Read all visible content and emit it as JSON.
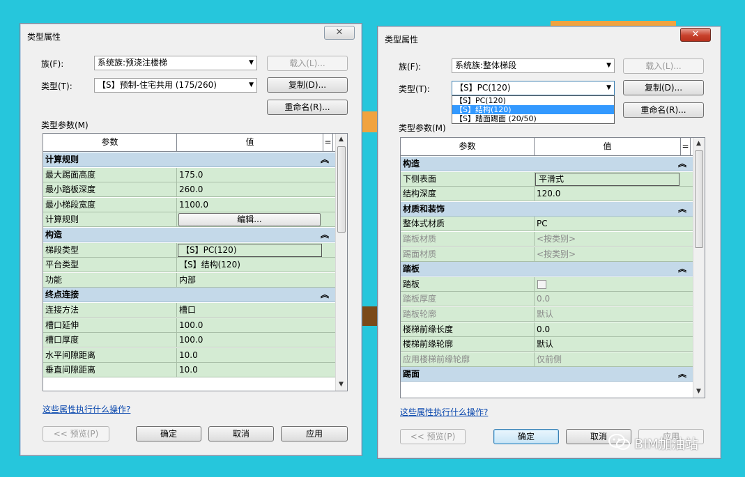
{
  "colors": {
    "background": "#26c6dc",
    "row_green": "#d4ebd3",
    "group_blue": "#c4d9e9",
    "selection": "#3399ff",
    "link": "#0645ad"
  },
  "left": {
    "title": "类型属性",
    "family_label": "族(F):",
    "family_value": "系统族:预浇注楼梯",
    "type_label": "类型(T):",
    "type_value": "【S】预制-住宅共用 (175/260)",
    "load_button": "载入(L)...",
    "duplicate_button": "复制(D)...",
    "rename_button": "重命名(R)...",
    "type_params_label": "类型参数(M)",
    "col_param": "参数",
    "col_value": "值",
    "col_eq": "=",
    "rows": [
      {
        "kind": "group",
        "name": "计算规则"
      },
      {
        "kind": "row",
        "name": "最大踢面高度",
        "value": "175.0"
      },
      {
        "kind": "row",
        "name": "最小踏板深度",
        "value": "260.0"
      },
      {
        "kind": "row",
        "name": "最小梯段宽度",
        "value": "1100.0"
      },
      {
        "kind": "row",
        "name": "计算规则",
        "value": "编辑...",
        "widget": "button"
      },
      {
        "kind": "group",
        "name": "构造"
      },
      {
        "kind": "row",
        "name": "梯段类型",
        "value": "【S】PC(120)",
        "widget": "box"
      },
      {
        "kind": "row",
        "name": "平台类型",
        "value": "【S】结构(120)"
      },
      {
        "kind": "row",
        "name": "功能",
        "value": "内部"
      },
      {
        "kind": "group",
        "name": "终点连接"
      },
      {
        "kind": "row",
        "name": "连接方法",
        "value": "槽口"
      },
      {
        "kind": "row",
        "name": "槽口延伸",
        "value": "100.0"
      },
      {
        "kind": "row",
        "name": "槽口厚度",
        "value": "100.0"
      },
      {
        "kind": "row",
        "name": "水平间隙距离",
        "value": "10.0"
      },
      {
        "kind": "row",
        "name": "垂直间隙距离",
        "value": "10.0"
      }
    ],
    "help_link": "这些属性执行什么操作?",
    "preview_button": "<< 预览(P)",
    "ok_button": "确定",
    "cancel_button": "取消",
    "apply_button": "应用"
  },
  "right": {
    "title": "类型属性",
    "family_label": "族(F):",
    "family_value": "系统族:整体梯段",
    "type_label": "类型(T):",
    "type_value": "【S】PC(120)",
    "type_options": [
      "【S】PC(120)",
      "【S】结构(120)",
      "【S】踏面踢面 (20/50)"
    ],
    "selected_option_index": 1,
    "load_button": "载入(L)...",
    "duplicate_button": "复制(D)...",
    "rename_button": "重命名(R)...",
    "type_params_label": "类型参数(M)",
    "col_param": "参数",
    "col_value": "值",
    "col_eq": "=",
    "rows": [
      {
        "kind": "group",
        "name": "构造"
      },
      {
        "kind": "row",
        "name": "下侧表面",
        "value": "平滑式",
        "widget": "box"
      },
      {
        "kind": "row",
        "name": "结构深度",
        "value": "120.0"
      },
      {
        "kind": "group",
        "name": "材质和装饰"
      },
      {
        "kind": "row",
        "name": "整体式材质",
        "value": "PC"
      },
      {
        "kind": "row",
        "name": "踏板材质",
        "value": "<按类别>",
        "grey": true
      },
      {
        "kind": "row",
        "name": "踢面材质",
        "value": "<按类别>",
        "grey": true
      },
      {
        "kind": "group",
        "name": "踏板"
      },
      {
        "kind": "row",
        "name": "踏板",
        "value": "",
        "widget": "checkbox"
      },
      {
        "kind": "row",
        "name": "踏板厚度",
        "value": "0.0",
        "grey": true
      },
      {
        "kind": "row",
        "name": "踏板轮廓",
        "value": "默认",
        "grey": true
      },
      {
        "kind": "row",
        "name": "楼梯前缘长度",
        "value": "0.0"
      },
      {
        "kind": "row",
        "name": "楼梯前缘轮廓",
        "value": "默认"
      },
      {
        "kind": "row",
        "name": "应用楼梯前缘轮廓",
        "value": "仅前侧",
        "grey": true
      },
      {
        "kind": "group",
        "name": "踢面"
      }
    ],
    "help_link": "这些属性执行什么操作?",
    "preview_button": "<< 预览(P)",
    "ok_button": "确定",
    "cancel_button": "取消",
    "apply_button": "应用"
  },
  "watermark": "BIM加油站"
}
